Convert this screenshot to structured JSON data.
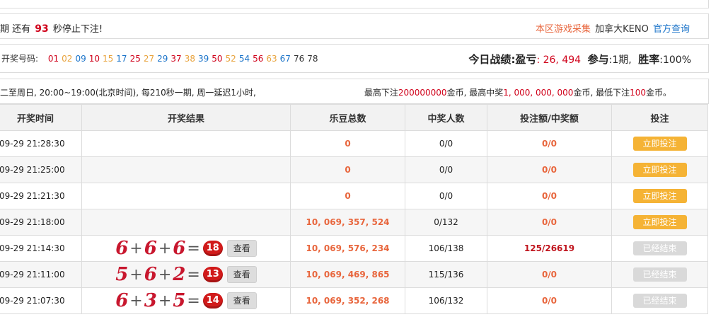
{
  "countdown": {
    "prefix": "期 还有",
    "seconds": "93",
    "suffix": "秒停止下注!"
  },
  "top_links": {
    "collect": "本区游戏采集",
    "game": "加拿大KENO",
    "official": "官方查询"
  },
  "numbers": {
    "label": "开奖号码:",
    "items": [
      {
        "v": "01",
        "c": "#d0021b"
      },
      {
        "v": "02",
        "c": "#e8a33d"
      },
      {
        "v": "09",
        "c": "#1a73c9"
      },
      {
        "v": "10",
        "c": "#d0021b"
      },
      {
        "v": "15",
        "c": "#e8a33d"
      },
      {
        "v": "17",
        "c": "#1a73c9"
      },
      {
        "v": "25",
        "c": "#d0021b"
      },
      {
        "v": "27",
        "c": "#e8a33d"
      },
      {
        "v": "29",
        "c": "#1a73c9"
      },
      {
        "v": "37",
        "c": "#d0021b"
      },
      {
        "v": "38",
        "c": "#e8a33d"
      },
      {
        "v": "39",
        "c": "#1a73c9"
      },
      {
        "v": "50",
        "c": "#d0021b"
      },
      {
        "v": "52",
        "c": "#e8a33d"
      },
      {
        "v": "54",
        "c": "#1a73c9"
      },
      {
        "v": "56",
        "c": "#d0021b"
      },
      {
        "v": "63",
        "c": "#e8a33d"
      },
      {
        "v": "67",
        "c": "#1a73c9"
      },
      {
        "v": "76",
        "c": "#333333"
      },
      {
        "v": "78",
        "c": "#333333"
      }
    ]
  },
  "stats": {
    "today_label": "今日战绩",
    "profit_label": ":盈亏",
    "profit_value": ": 26, 494",
    "participate_label": "参与",
    "participate_value": ":1期,",
    "winrate_label": "胜率",
    "winrate_value": ":100%"
  },
  "schedule": {
    "text": "二至周日, 20:00~19:00(北京时间), 每210秒一期, 周一延迟1小时,",
    "limits_p1": "最高下注",
    "max_bet": "200000000",
    "limits_p2": "金币, 最高中奖",
    "max_win": "1, 000, 000, 000",
    "limits_p3": "金币, 最低下注",
    "min_bet": "100",
    "limits_p4": "金币。"
  },
  "table": {
    "headers": [
      "开奖时间",
      "开奖结果",
      "乐豆总数",
      "中奖人数",
      "投注额/中奖额",
      "投注"
    ],
    "view_label": "查看",
    "rows": [
      {
        "time": "09-29 21:28:30",
        "result": null,
        "total": "0",
        "winners": "0/0",
        "ratio": "0/0",
        "action": "立即投注",
        "status": "active"
      },
      {
        "time": "09-29 21:25:00",
        "result": null,
        "total": "0",
        "winners": "0/0",
        "ratio": "0/0",
        "action": "立即投注",
        "status": "active"
      },
      {
        "time": "09-29 21:21:30",
        "result": null,
        "total": "0",
        "winners": "0/0",
        "ratio": "0/0",
        "action": "立即投注",
        "status": "active"
      },
      {
        "time": "09-29 21:18:00",
        "result": null,
        "total": "10, 069, 357, 524",
        "winners": "0/132",
        "ratio": "0/0",
        "action": "立即投注",
        "status": "active"
      },
      {
        "time": "09-29 21:14:30",
        "result": {
          "a": "6",
          "b": "6",
          "c": "6",
          "sum": "18"
        },
        "total": "10, 069, 576, 234",
        "winners": "106/138",
        "ratio": "125/26619",
        "action": "已经结束",
        "status": "ended"
      },
      {
        "time": "09-29 21:11:00",
        "result": {
          "a": "5",
          "b": "6",
          "c": "2",
          "sum": "13"
        },
        "total": "10, 069, 469, 865",
        "winners": "115/136",
        "ratio": "0/0",
        "action": "已经结束",
        "status": "ended"
      },
      {
        "time": "09-29 21:07:30",
        "result": {
          "a": "6",
          "b": "3",
          "c": "5",
          "sum": "14"
        },
        "total": "10, 069, 352, 268",
        "winners": "106/132",
        "ratio": "0/0",
        "action": "已经结束",
        "status": "ended"
      }
    ]
  },
  "colors": {
    "accent_orange": "#e8663d",
    "red": "#d0021b",
    "blue": "#1a73c9",
    "button_active": "#f5b335",
    "button_ended": "#d9d9d9"
  }
}
